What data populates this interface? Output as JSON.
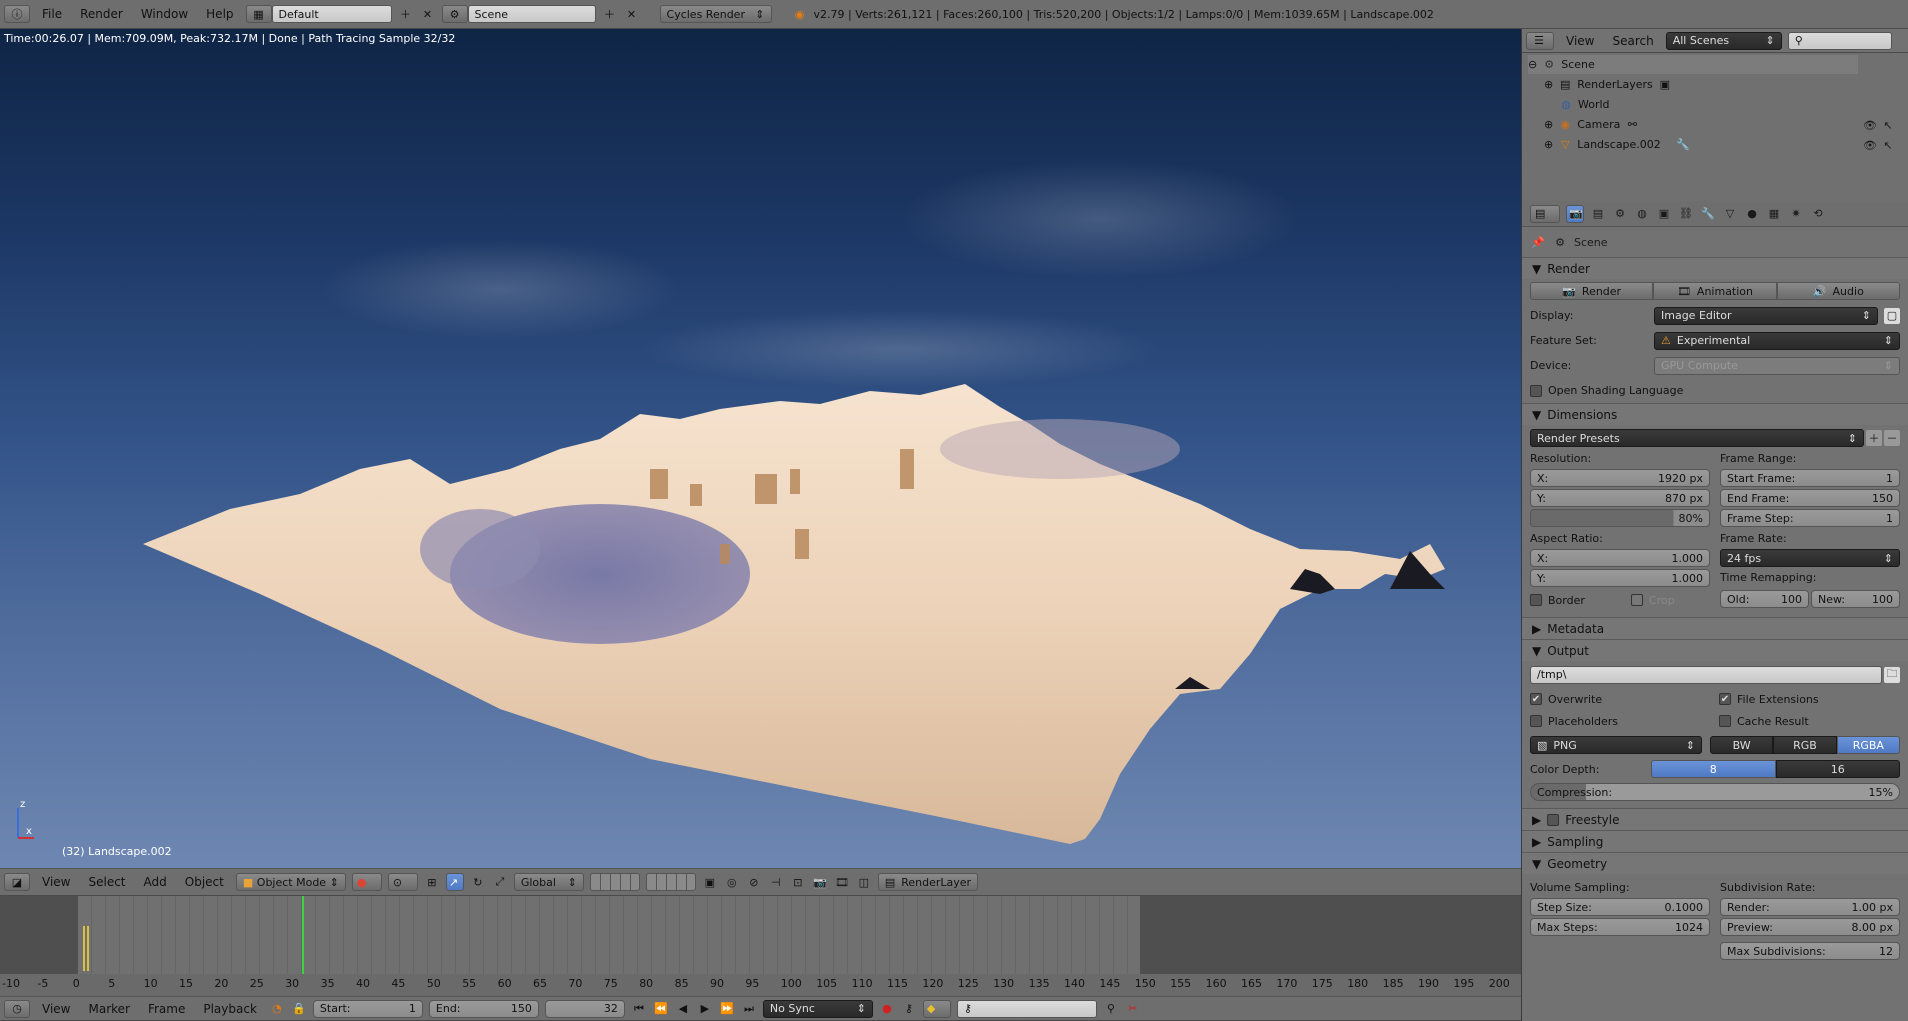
{
  "topbar": {
    "menus": [
      "File",
      "Render",
      "Window",
      "Help"
    ],
    "layout": "Default",
    "scene": "Scene",
    "engine": "Cycles Render",
    "stats": "v2.79 | Verts:261,121 | Faces:260,100 | Tris:520,200 | Objects:1/2 | Lamps:0/0 | Mem:1039.65M | Landscape.002"
  },
  "viewport": {
    "status": "Time:00:26.07 | Mem:709.09M, Peak:732.17M | Done | Path Tracing Sample 32/32",
    "object_label": "(32) Landscape.002",
    "menus": [
      "View",
      "Select",
      "Add",
      "Object"
    ],
    "mode": "Object Mode",
    "orientation": "Global",
    "render_layer": "RenderLayer",
    "axis_x": "x",
    "axis_z": "z"
  },
  "outliner": {
    "menus": [
      "View",
      "Search"
    ],
    "scenes_dropdown": "All Scenes",
    "items": [
      {
        "label": "Scene",
        "icon": "scene-icon"
      },
      {
        "label": "RenderLayers",
        "icon": "renderlayers-icon"
      },
      {
        "label": "World",
        "icon": "world-icon"
      },
      {
        "label": "Camera",
        "icon": "camera-icon"
      },
      {
        "label": "Landscape.002",
        "icon": "mesh-icon"
      }
    ]
  },
  "properties": {
    "context": "Scene",
    "render_panel": "Render",
    "render_buttons": [
      "Render",
      "Animation",
      "Audio"
    ],
    "display_label": "Display:",
    "display_value": "Image Editor",
    "feature_label": "Feature Set:",
    "feature_value": "Experimental",
    "device_label": "Device:",
    "device_value": "GPU Compute",
    "osl": "Open Shading Language",
    "dimensions_panel": "Dimensions",
    "render_presets": "Render Presets",
    "resolution_label": "Resolution:",
    "res_x_label": "X:",
    "res_x": "1920 px",
    "res_y_label": "Y:",
    "res_y": "870 px",
    "res_pct": "80%",
    "frame_range_label": "Frame Range:",
    "start_frame_label": "Start Frame:",
    "start_frame": "1",
    "end_frame_label": "End Frame:",
    "end_frame": "150",
    "frame_step_label": "Frame Step:",
    "frame_step": "1",
    "aspect_label": "Aspect Ratio:",
    "aspect_x_label": "X:",
    "aspect_x": "1.000",
    "aspect_y_label": "Y:",
    "aspect_y": "1.000",
    "frame_rate_label": "Frame Rate:",
    "frame_rate": "24 fps",
    "time_remap_label": "Time Remapping:",
    "old_label": "Old:",
    "old_value": "100",
    "new_label": "New:",
    "new_value": "100",
    "border": "Border",
    "crop": "Crop",
    "metadata_panel": "Metadata",
    "output_panel": "Output",
    "output_path": "/tmp\\",
    "overwrite": "Overwrite",
    "file_extensions": "File Extensions",
    "placeholders": "Placeholders",
    "cache_result": "Cache Result",
    "format": "PNG",
    "color_modes": [
      "BW",
      "RGB",
      "RGBA"
    ],
    "color_depth_label": "Color Depth:",
    "color_depths": [
      "8",
      "16"
    ],
    "compression_label": "Compression:",
    "compression_value": "15%",
    "freestyle_panel": "Freestyle",
    "sampling_panel": "Sampling",
    "geometry_panel": "Geometry",
    "volume_sampling_label": "Volume Sampling:",
    "step_size_label": "Step Size:",
    "step_size": "0.1000",
    "max_steps_label": "Max Steps:",
    "max_steps": "1024",
    "subdiv_rate_label": "Subdivision Rate:",
    "subdiv_render_label": "Render:",
    "subdiv_render": "1.00 px",
    "preview_label": "Preview:",
    "preview_value": "8.00 px",
    "max_subdiv_label": "Max Subdivisions:",
    "max_subdiv": "12"
  },
  "timeline": {
    "ruler": [
      "-10",
      "-5",
      "0",
      "5",
      "10",
      "15",
      "20",
      "25",
      "30",
      "35",
      "40",
      "45",
      "50",
      "55",
      "60",
      "65",
      "70",
      "75",
      "80",
      "85",
      "90",
      "95",
      "100",
      "105",
      "110",
      "115",
      "120",
      "125",
      "130",
      "135",
      "140",
      "145",
      "150",
      "155",
      "160",
      "165",
      "170",
      "175",
      "180",
      "185",
      "190",
      "195",
      "200"
    ],
    "current_frame": "32",
    "menus": [
      "View",
      "Marker",
      "Frame",
      "Playback"
    ],
    "start_label": "Start:",
    "start": "1",
    "end_label": "End:",
    "end": "150",
    "sync": "No Sync"
  }
}
